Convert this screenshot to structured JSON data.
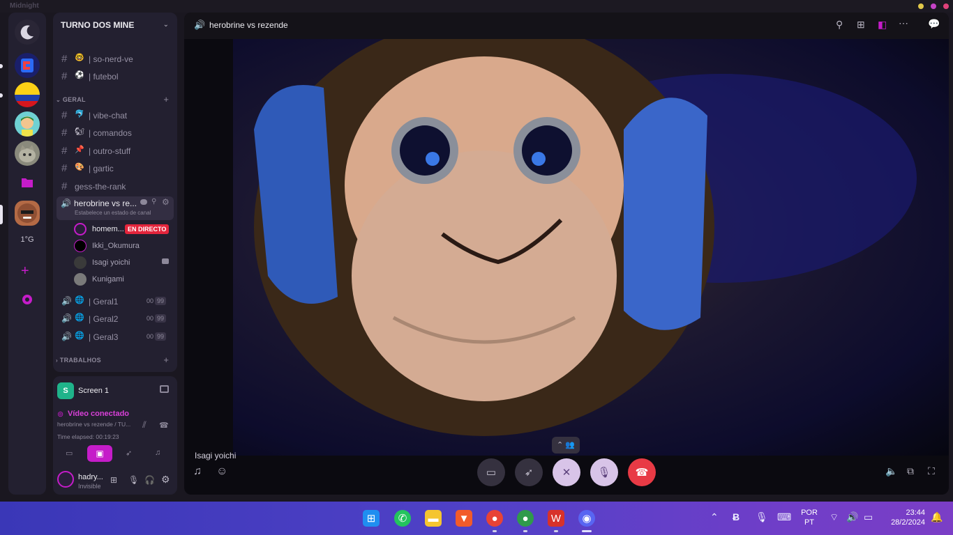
{
  "window": {
    "title": "Midnight"
  },
  "rail": {
    "servers": [
      {
        "name": "Cube server",
        "color": "#2a5df0"
      },
      {
        "name": "Colombia server",
        "color": "#fcd116"
      },
      {
        "name": "Cartoon server",
        "color": "#6fd1d3"
      },
      {
        "name": "Cat server",
        "color": "#8a8a7c"
      },
      {
        "name": "Folder",
        "color": "#c51cc9"
      },
      {
        "name": "Current server",
        "color": "#b46a45"
      }
    ],
    "server_text": "1°G"
  },
  "guild": {
    "name": "TURNO DOS MINE",
    "top_channels": [
      {
        "emoji": "🤓",
        "label": "| so-nerd-ve"
      },
      {
        "emoji": "⚽",
        "label": "| futebol"
      }
    ],
    "category_geral": "GERAL",
    "geral_channels": [
      {
        "emoji": "🐬",
        "label": "| vibe-chat"
      },
      {
        "emoji": "🐿",
        "label": "| comandos"
      },
      {
        "emoji": "📌",
        "label": "| outro-stuff"
      },
      {
        "emoji": "🎨",
        "label": "| gartic"
      },
      {
        "emoji": "",
        "label": "gess-the-rank"
      }
    ],
    "active_voice": {
      "name": "herobrine vs re...",
      "status_hint": "Estabelece un estado de canal"
    },
    "voice_users": [
      {
        "name": "homem...",
        "live": "EN DIRECTO"
      },
      {
        "name": "Ikki_Okumura"
      },
      {
        "name": "Isagi yoichi"
      },
      {
        "name": "Kunigami"
      }
    ],
    "voice_channels": [
      {
        "emoji": "🌐",
        "label": "| Geral1",
        "count_a": "00",
        "count_b": "99"
      },
      {
        "emoji": "🌐",
        "label": "| Geral2",
        "count_a": "00",
        "count_b": "99"
      },
      {
        "emoji": "🌐",
        "label": "| Geral3",
        "count_a": "00",
        "count_b": "99"
      }
    ],
    "category_trabalhos": "TRABALHOS"
  },
  "voice_panel": {
    "screen_label": "Screen 1",
    "status": "Vídeo conectado",
    "channel_path": "herobrine vs rezende / TU...",
    "elapsed": "Time elapsed: 00:19:23"
  },
  "user": {
    "name": "hadry...",
    "status": "Invisible"
  },
  "stage": {
    "title": "herobrine vs rezende",
    "speaker": "Isagi yoichi"
  },
  "taskbar": {
    "lang": "POR",
    "region": "PT",
    "time": "23:44",
    "date": "28/2/2024"
  }
}
